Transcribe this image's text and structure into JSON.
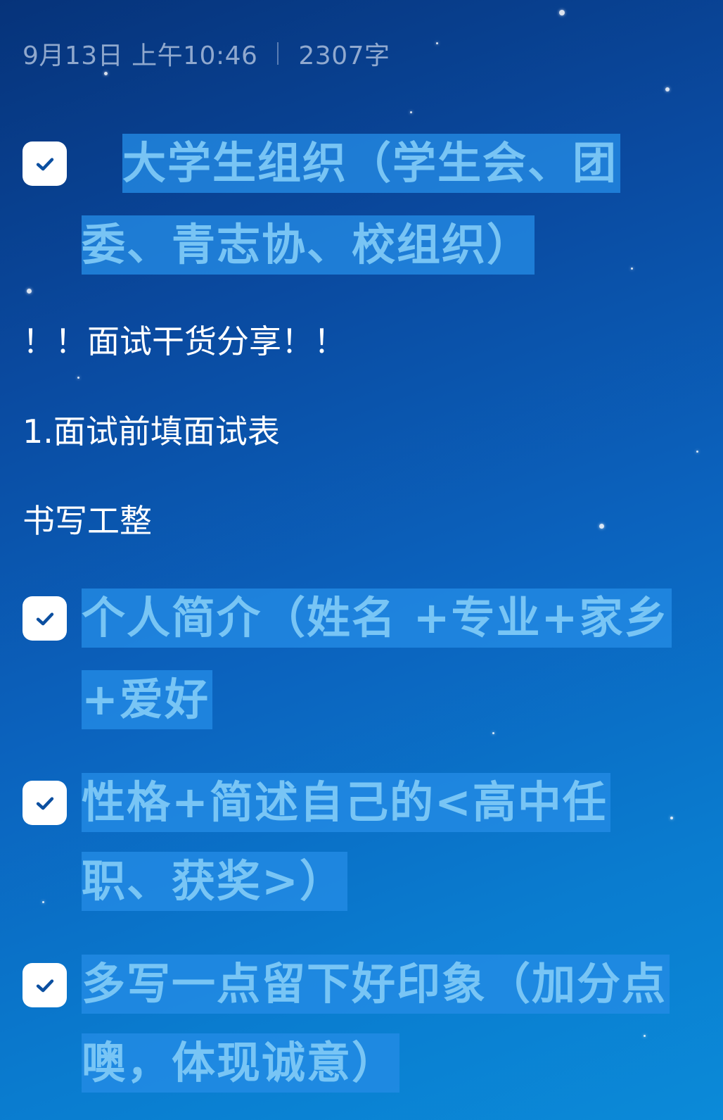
{
  "note": {
    "date": "9月13日 上午10:46",
    "word_count": "2307字"
  },
  "items": [
    {
      "type": "checked",
      "lines": [
        "大学生组织（学生会、团",
        "委、青志协、校组织）"
      ]
    },
    {
      "type": "text",
      "text": "！！面试干货分享！！"
    },
    {
      "type": "text",
      "text": "1.面试前填面试表"
    },
    {
      "type": "text",
      "text": "书写工整"
    },
    {
      "type": "checked",
      "lines": [
        "个人简介（姓名 +专业+家乡",
        "+爱好"
      ]
    },
    {
      "type": "checked",
      "lines": [
        "性格+简述自己的<高中任",
        "职、获奖>）"
      ]
    },
    {
      "type": "checked",
      "lines": [
        "多写一点留下好印象（加分点",
        "噢，体现诚意）"
      ]
    }
  ],
  "colors": {
    "highlight": "#248ce6",
    "highlight_text": "#7dc8f5",
    "check_bg": "#ffffff",
    "check_mark": "#0b4fa0"
  }
}
